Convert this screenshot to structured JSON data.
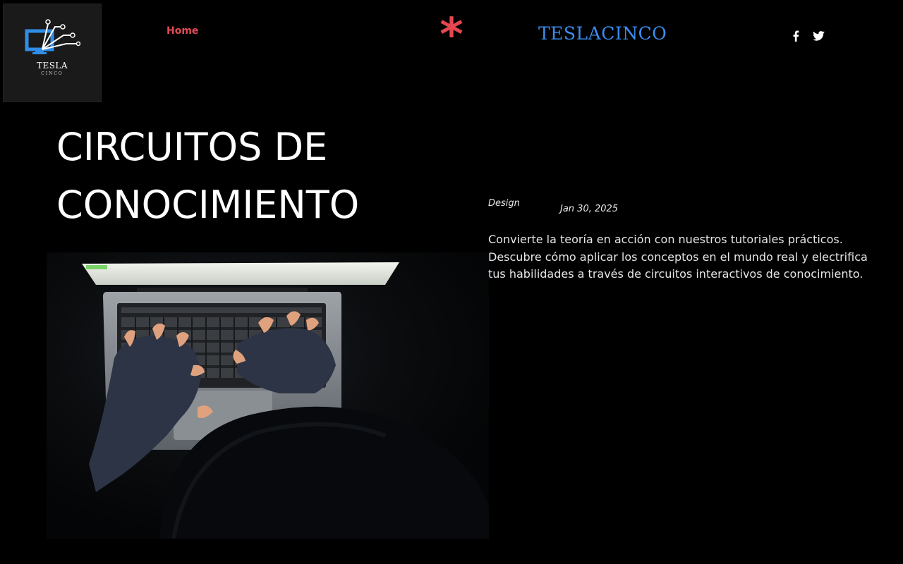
{
  "header": {
    "logo": {
      "word": "TESLA",
      "sub": "CINCO"
    },
    "nav": {
      "home_label": "Home"
    },
    "asterisk": "*",
    "brand": "TESLACINCO",
    "social": [
      {
        "icon": "facebook-icon"
      },
      {
        "icon": "twitter-icon"
      }
    ]
  },
  "hero": {
    "title": "CIRCUITOS DE CONOCIMIENTO",
    "category": "Design",
    "date": "Jan 30, 2025",
    "description": "Convierte la teoría en acción con nuestros tutoriales prácticos. Descubre cómo aplicar los conceptos en el mundo real y electrifica tus habilidades a través de circuitos interactivos de conocimiento."
  },
  "colors": {
    "background": "#000000",
    "nav_accent": "#e04a55",
    "asterisk": "#e5484f",
    "brand": "#3a8ef0"
  }
}
